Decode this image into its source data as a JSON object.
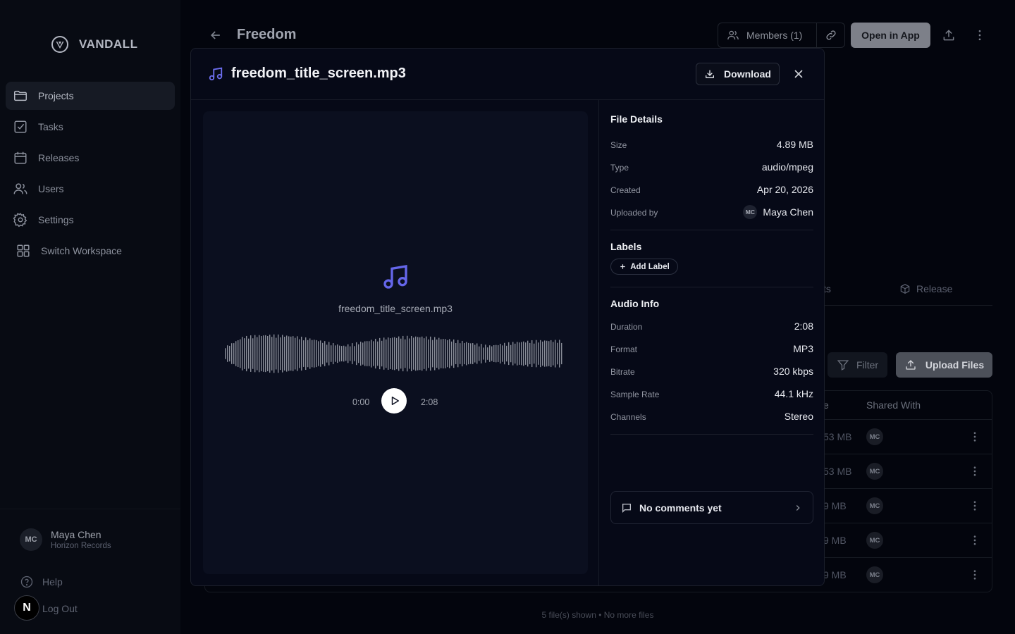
{
  "sidebar": {
    "brand": "VANDALL",
    "items": [
      {
        "label": "Projects",
        "icon": "folder-icon"
      },
      {
        "label": "Tasks",
        "icon": "checkbox-icon"
      },
      {
        "label": "Releases",
        "icon": "calendar-icon"
      },
      {
        "label": "Users",
        "icon": "users-icon"
      },
      {
        "label": "Settings",
        "icon": "gear-icon"
      },
      {
        "label": "Switch Workspace",
        "icon": "grid-icon"
      }
    ],
    "user": {
      "initials": "MC",
      "name": "Maya Chen",
      "org": "Horizon Records"
    },
    "help": "Help",
    "logout": "Log Out",
    "badge": "N"
  },
  "page": {
    "title": "Freedom",
    "members": "Members (1)",
    "open_app": "Open in App",
    "tab_partial": "ts",
    "tab_release": "Release",
    "filter": "Filter",
    "upload": "Upload Files",
    "col_size_partial": "e",
    "col_shared": "Shared With",
    "rows": [
      {
        "size": "53 MB",
        "shared": "MC"
      },
      {
        "size": "53 MB",
        "shared": "MC"
      },
      {
        "size": "9 MB",
        "shared": "MC"
      },
      {
        "size": "9 MB",
        "shared": "MC"
      },
      {
        "size": "9 MB",
        "shared": "MC"
      }
    ],
    "footer": "5 file(s) shown • No more files"
  },
  "modal": {
    "filename": "freedom_title_screen.mp3",
    "download": "Download",
    "player": {
      "current": "0:00",
      "total": "2:08",
      "progress": 0
    },
    "file_details": {
      "title": "File Details",
      "size_label": "Size",
      "size": "4.89 MB",
      "type_label": "Type",
      "type": "audio/mpeg",
      "created_label": "Created",
      "created": "Apr 20, 2026",
      "uploaded_label": "Uploaded by",
      "uploader_initials": "MC",
      "uploader": "Maya Chen"
    },
    "labels": {
      "title": "Labels",
      "add": "Add Label"
    },
    "audio_info": {
      "title": "Audio Info",
      "duration_label": "Duration",
      "duration": "2:08",
      "format_label": "Format",
      "format": "MP3",
      "bitrate_label": "Bitrate",
      "bitrate": "320 kbps",
      "sample_label": "Sample Rate",
      "sample": "44.1 kHz",
      "channels_label": "Channels",
      "channels": "Stereo"
    },
    "comments": "No comments yet"
  },
  "colors": {
    "accent": "#6566ea",
    "background": "#03050d",
    "modal": "#060917"
  }
}
